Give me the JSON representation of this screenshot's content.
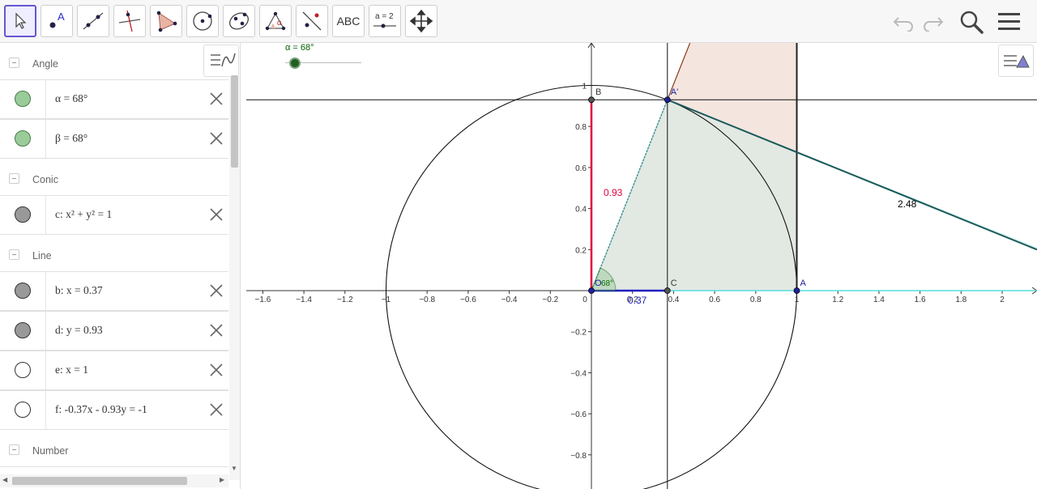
{
  "toolbar": {
    "tools": [
      {
        "name": "move-tool-icon",
        "label": ""
      },
      {
        "name": "point-tool-icon",
        "label": "A"
      },
      {
        "name": "line-tool-icon",
        "label": ""
      },
      {
        "name": "perpendicular-line-tool-icon",
        "label": ""
      },
      {
        "name": "polygon-tool-icon",
        "label": ""
      },
      {
        "name": "circle-tool-icon",
        "label": ""
      },
      {
        "name": "ellipse-tool-icon",
        "label": ""
      },
      {
        "name": "angle-tool-icon",
        "label": "α"
      },
      {
        "name": "reflect-tool-icon",
        "label": ""
      },
      {
        "name": "text-tool-icon",
        "label": "ABC"
      },
      {
        "name": "slider-tool-icon",
        "label": "a = 2"
      },
      {
        "name": "move-graphics-tool-icon",
        "label": ""
      }
    ]
  },
  "algebra": {
    "groups": [
      {
        "label": "Angle",
        "items": [
          {
            "expr": "α = 68°",
            "marker": "green"
          },
          {
            "expr": "β = 68°",
            "marker": "green"
          }
        ]
      },
      {
        "label": "Conic",
        "items": [
          {
            "expr": "c: x² + y² = 1",
            "marker": "gray"
          }
        ]
      },
      {
        "label": "Line",
        "items": [
          {
            "expr": "b: x = 0.37",
            "marker": "gray"
          },
          {
            "expr": "d: y = 0.93",
            "marker": "gray"
          },
          {
            "expr": "e: x = 1",
            "marker": "white"
          },
          {
            "expr": "f: -0.37x - 0.93y = -1",
            "marker": "white"
          }
        ]
      },
      {
        "label": "Number",
        "items": []
      }
    ]
  },
  "graphics": {
    "slider_label": "α = 68°",
    "x_ticks": [
      "−1.6",
      "−1.4",
      "−1.2",
      "−1",
      "−0.8",
      "−0.6",
      "−0.4",
      "−0.2",
      "0",
      "0.2",
      "0.4",
      "0.6",
      "0.8",
      "1",
      "1.2",
      "1.4",
      "1.6",
      "1.8",
      "2"
    ],
    "x_tick_values": [
      -1.6,
      -1.4,
      -1.2,
      -1,
      -0.8,
      -0.6,
      -0.4,
      -0.2,
      0,
      0.2,
      0.4,
      0.6,
      0.8,
      1,
      1.2,
      1.4,
      1.6,
      1.8,
      2
    ],
    "y_ticks": [
      "1",
      "0.8",
      "0.6",
      "0.4",
      "0.2",
      "−0.2",
      "−0.4",
      "−0.6",
      "−0.8"
    ],
    "y_tick_values": [
      1,
      0.8,
      0.6,
      0.4,
      0.2,
      -0.2,
      -0.4,
      -0.6,
      -0.8
    ],
    "points": {
      "O": "O",
      "A": "A",
      "A_prime": "A'",
      "B": "B",
      "C": "C"
    },
    "point_coords": {
      "O": [
        0,
        0
      ],
      "A": [
        1,
        0
      ],
      "A_prime": [
        0.37,
        0.93
      ],
      "B": [
        0,
        0.93
      ],
      "C": [
        0.37,
        0
      ]
    },
    "labels": {
      "sin": "0.93",
      "cos": "0.37",
      "sec": "2.48",
      "angle": "68°"
    },
    "colors": {
      "red": "#e0003c",
      "blue": "#2020c0",
      "teal_fill": "#d0f4f4",
      "green_fill": "#dfe6df",
      "pink_fill": "#f3e2dc",
      "angle_green": "#007000"
    }
  }
}
